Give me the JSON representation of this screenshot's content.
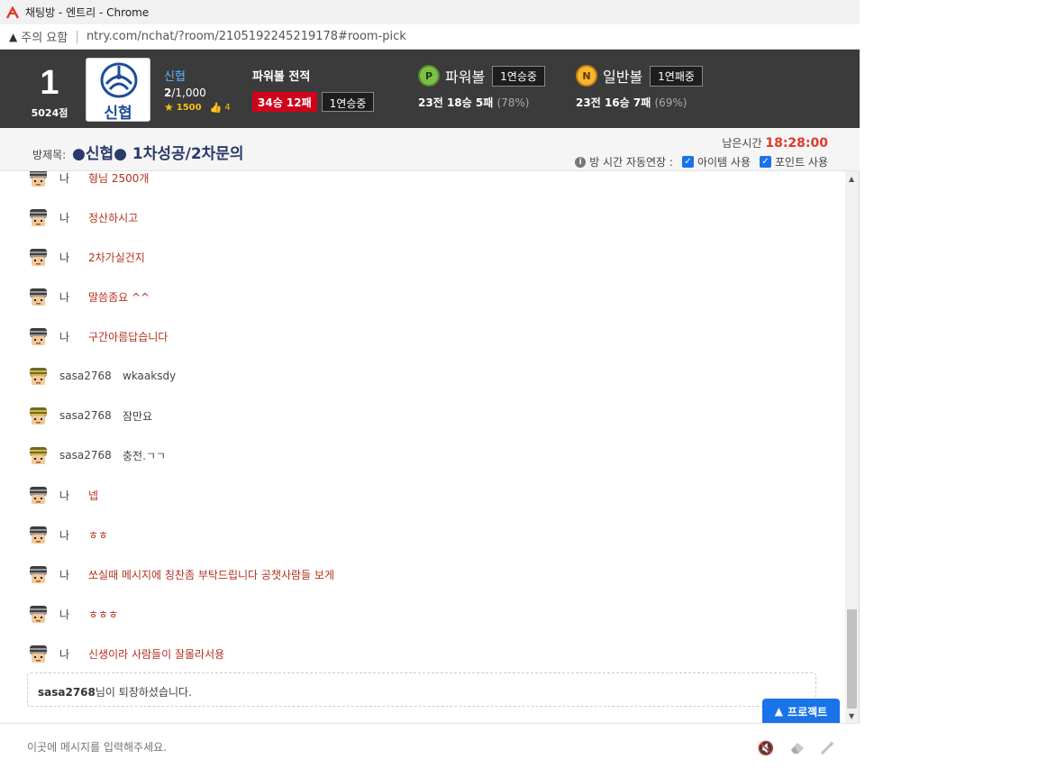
{
  "browser": {
    "title": "채팅방 - 엔트리 - Chrome",
    "security_label": "주의 요함",
    "url": "ntry.com/nchat/?room/2105192245219178#room-pick"
  },
  "header": {
    "rank": "1",
    "points": "5024점",
    "logo_text": "신협",
    "club_name": "신협",
    "members_current": "2",
    "members_max": "/1,000",
    "level": "1500",
    "likes": "4",
    "record_title": "파워볼 전적",
    "record_wl": "34승 12패",
    "record_streak": "1연승중",
    "powerball": {
      "coin": "P",
      "name": "파워볼",
      "streak": "1연승중",
      "games": "23전",
      "wins": "18승",
      "losses": "5패",
      "pct": "(78%)"
    },
    "normalball": {
      "coin": "N",
      "name": "일반볼",
      "streak": "1연패중",
      "games": "23전",
      "wins": "16승",
      "losses": "7패",
      "pct": "(69%)"
    }
  },
  "room": {
    "label": "방제목:",
    "title": "●신협● 1차성공/2차문의",
    "remaining_label": "남은시간",
    "remaining_time": "18:28:00",
    "auto_extend_label": "방 시간 자동연장 :",
    "item_label": "아이템 사용",
    "point_label": "포인트 사용"
  },
  "messages": [
    {
      "sender": "나",
      "text": "형님 2500개",
      "me": true
    },
    {
      "sender": "나",
      "text": "정산하시고",
      "me": true
    },
    {
      "sender": "나",
      "text": "2차가실건지",
      "me": true
    },
    {
      "sender": "나",
      "text": "말씀좀요 ^^",
      "me": true
    },
    {
      "sender": "나",
      "text": "구간아름답습니다",
      "me": true
    },
    {
      "sender": "sasa2768",
      "text": "wkaaksdy",
      "me": false
    },
    {
      "sender": "sasa2768",
      "text": "잠만요",
      "me": false
    },
    {
      "sender": "sasa2768",
      "text": "충전.ㄱㄱ",
      "me": false
    },
    {
      "sender": "나",
      "text": "넵",
      "me": true
    },
    {
      "sender": "나",
      "text": "ㅎㅎ",
      "me": true
    },
    {
      "sender": "나",
      "text": "쏘실때 메시지에 칭찬좀 부탁드립니다 공챗사람들 보게",
      "me": true
    },
    {
      "sender": "나",
      "text": "ㅎㅎㅎ",
      "me": true
    },
    {
      "sender": "나",
      "text": "신생이라 사람들이 잘몰라서용",
      "me": true
    }
  ],
  "notice": {
    "user": "sasa2768",
    "text": "님이 퇴장하셨습니다."
  },
  "protect_button": "프로젝트",
  "input": {
    "placeholder": "이곳에 메시지를 입력해주세요."
  },
  "colors": {
    "header_bg": "#3b3b3b",
    "my_text": "#b5311f",
    "accent": "#1a73e8",
    "timer": "#e0392b"
  }
}
